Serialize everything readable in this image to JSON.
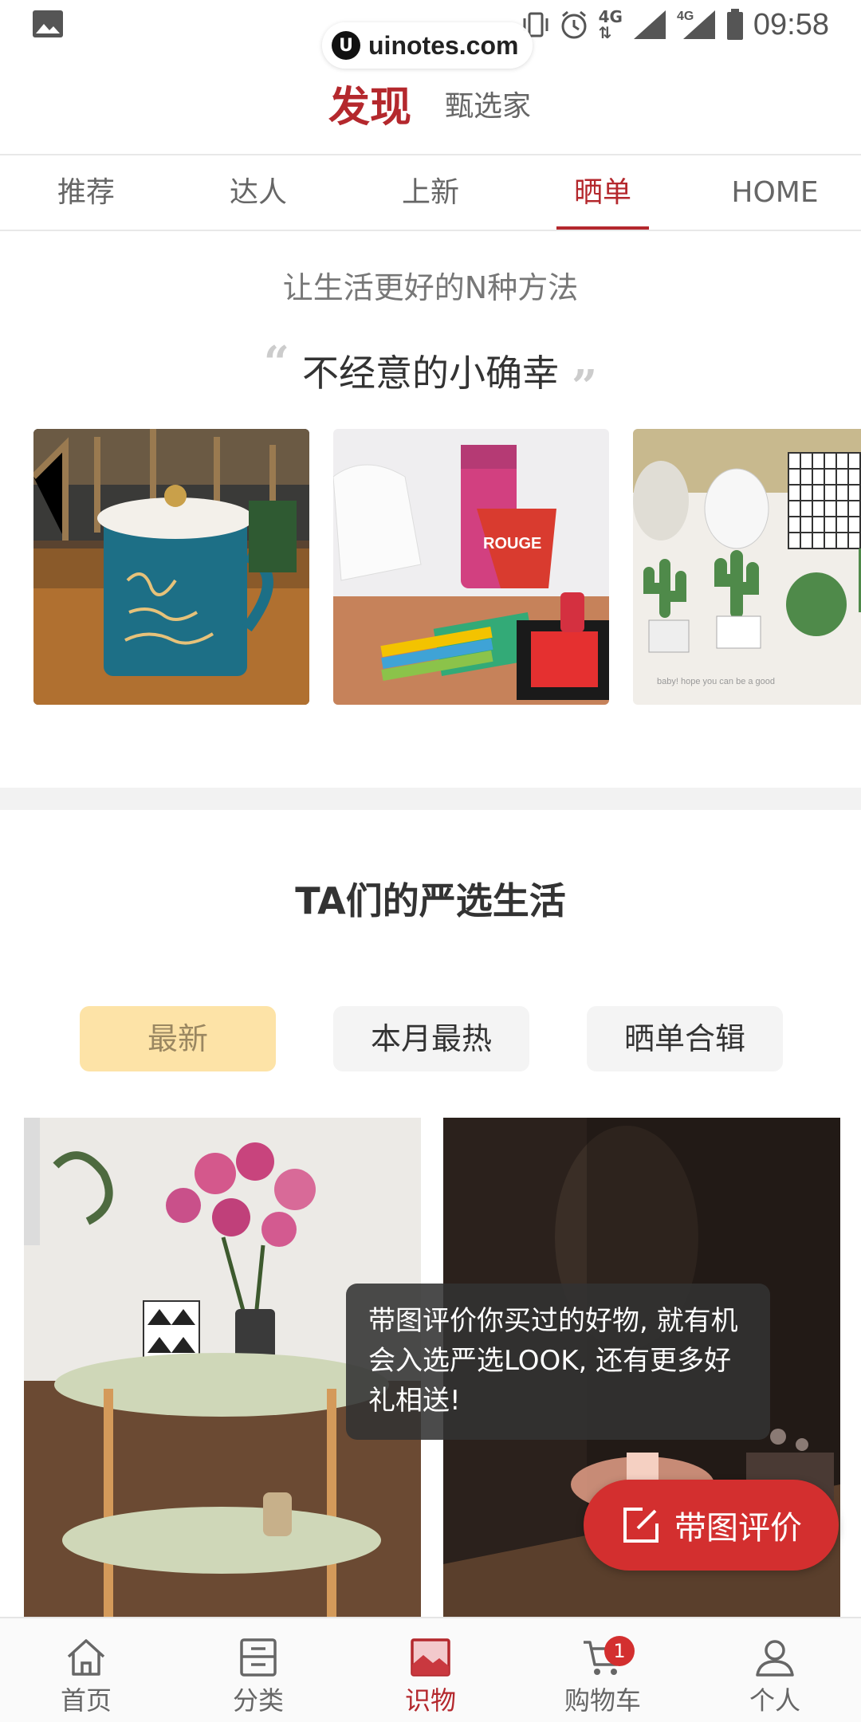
{
  "status_bar": {
    "time": "09:58",
    "network_1": "4G",
    "network_2": "4G",
    "watermark_logo": "U",
    "watermark_text": "uinotes.com"
  },
  "header": {
    "active_tab": "发现",
    "other_tab": "甄选家"
  },
  "category_tabs": [
    "推荐",
    "达人",
    "上新",
    "晒单",
    "HOME"
  ],
  "active_category_index": 3,
  "intro": {
    "subtitle": "让生活更好的N种方法",
    "quote_open": "“",
    "quote_title": "不经意的小确幸",
    "quote_close": "”"
  },
  "section": {
    "title": "TA们的严选生活",
    "filters": [
      "最新",
      "本月最热",
      "晒单合辑"
    ]
  },
  "tooltip": "带图评价你买过的好物, 就有机会入选严选LOOK, 还有更多好礼相送!",
  "fab_label": "带图评价",
  "bottom_nav": {
    "items": [
      "首页",
      "分类",
      "识物",
      "购物车",
      "个人"
    ],
    "active_index": 2,
    "cart_badge": "1"
  },
  "colors": {
    "brand_red": "#b4282d",
    "fab_red": "#d32f2f",
    "active_filter_bg": "#fde3a7"
  }
}
